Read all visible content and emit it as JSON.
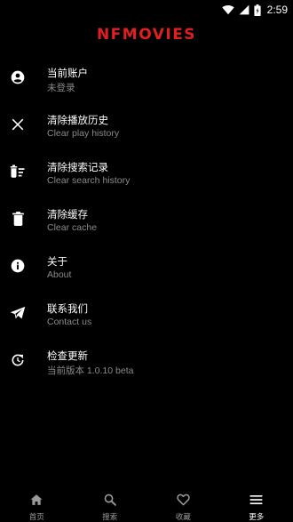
{
  "status_bar": {
    "time": "2:59"
  },
  "app": {
    "logo_text": "NFMOVIES",
    "accent_color": "#e02020"
  },
  "menu": {
    "items": [
      {
        "icon": "account-circle-icon",
        "title": "当前账户",
        "subtitle": "未登录"
      },
      {
        "icon": "close-icon",
        "title": "清除播放历史",
        "subtitle": "Clear play history"
      },
      {
        "icon": "delete-sweep-icon",
        "title": "清除搜索记录",
        "subtitle": "Clear search history"
      },
      {
        "icon": "trash-icon",
        "title": "清除缓存",
        "subtitle": "Clear cache"
      },
      {
        "icon": "info-icon",
        "title": "关于",
        "subtitle": "About"
      },
      {
        "icon": "telegram-icon",
        "title": "联系我们",
        "subtitle": "Contact us"
      },
      {
        "icon": "update-icon",
        "title": "检查更新",
        "subtitle": "当前版本 1.0.10 beta"
      }
    ]
  },
  "bottom_nav": {
    "items": [
      {
        "icon": "home-icon",
        "label": "首页",
        "active": false
      },
      {
        "icon": "search-icon",
        "label": "搜索",
        "active": false
      },
      {
        "icon": "heart-icon",
        "label": "收藏",
        "active": false
      },
      {
        "icon": "menu-icon",
        "label": "更多",
        "active": true
      }
    ]
  }
}
